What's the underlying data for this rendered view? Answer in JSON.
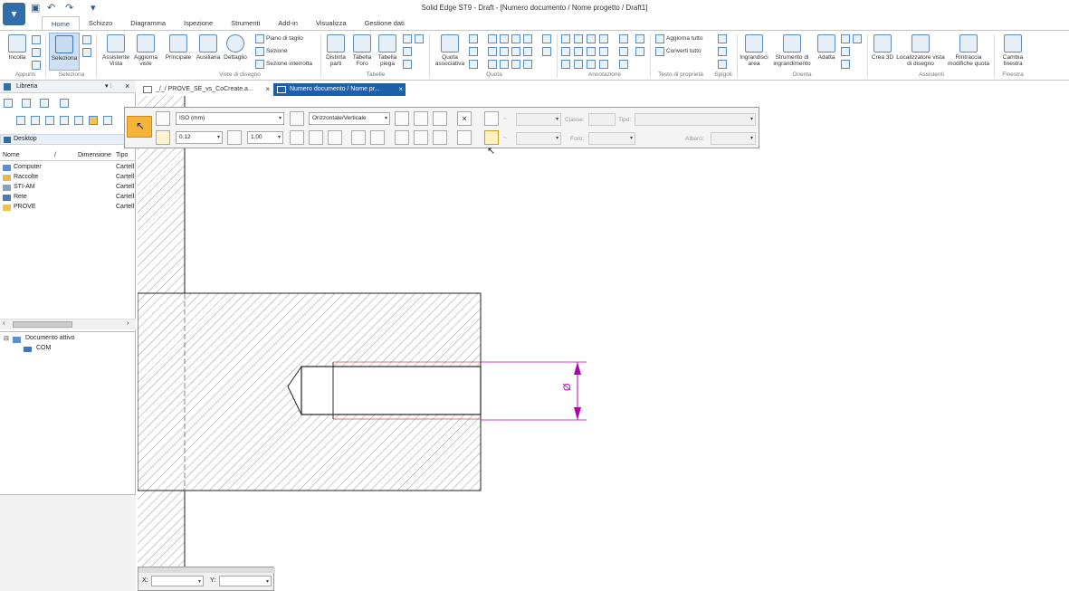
{
  "window": {
    "title": "Solid Edge ST9 - Draft - [Numero documento / Nome progetto / Draft1]"
  },
  "tabs": [
    "Home",
    "Schizzo",
    "Diagramma",
    "Ispezione",
    "Strumenti",
    "Add-in",
    "Visualizza",
    "Gestione dati"
  ],
  "ribbon": {
    "incolla": "Incolla",
    "seleziona": "Seleziona",
    "assistente_vista": "Assistente Vista",
    "aggiorna_viste": "Aggiorna viste",
    "principale": "Principale",
    "ausiliaria": "Ausiliaria",
    "dettaglio": "Dettaglio",
    "piano_taglio": "Piano di taglio",
    "sezione": "Sezione",
    "sezione_interrotta": "Sezione interrotta",
    "distinta_parti": "Distinta parti",
    "tabella_foro": "Tabella Foro",
    "tabella_piega": "Tabella piega",
    "quota_associativa": "Quota associativa",
    "aggiorna_tutto": "Aggiorna tutto",
    "converti_tutto": "Converti tutto",
    "ingrandisci_area": "Ingrandisci area",
    "strumento_ingrandimento": "Strumento di ingrandimento",
    "adatta": "Adatta",
    "crea_3d": "Crea 3D",
    "localizzatore": "Localizzatore vista di disegno",
    "rintraccia": "Rintraccia modifiche quota",
    "cambia_finestra": "Cambia finestra",
    "groups": {
      "appunti": "Appunti",
      "seleziona": "Seleziona",
      "viste": "Viste di disegno",
      "tabelle": "Tabelle",
      "quota": "Quota",
      "annotazione": "Annotazione",
      "testo": "Testo di proprietà",
      "spigoli": "Spigoli",
      "orienta": "Orienta",
      "assistenti": "Assistenti",
      "finestra": "Finestra"
    }
  },
  "library": {
    "title": "Libreria",
    "folder": "Desktop",
    "columns": [
      "Nome",
      "/",
      "Dimensione",
      "Tipo"
    ],
    "items": [
      {
        "name": "Computer",
        "type": "Cartell"
      },
      {
        "name": "Raccolte",
        "type": "Cartell"
      },
      {
        "name": "STI-AM",
        "type": "Cartell"
      },
      {
        "name": "Rete",
        "type": "Cartell"
      },
      {
        "name": "PROVE",
        "type": "Cartell"
      }
    ],
    "tree": {
      "root": "Documento attivo",
      "child": "COM"
    }
  },
  "doc_tabs": [
    {
      "label": "_/_/ PROVE_SE_vs_CoCreate.a...",
      "active": false
    },
    {
      "label": "Numero documento / Nome pr...",
      "active": true
    }
  ],
  "command_bar": {
    "style": "ISO (mm)",
    "orientation": "Orizzontale/Verticale",
    "precision": "0.12",
    "scale": "1.00",
    "x_close": "×",
    "dash1": "~",
    "dash2": "~",
    "classe_label": "Classe:",
    "tipo_label": "Tipo:",
    "foro_label": "Foro:",
    "albero_label": "Albero:"
  },
  "dimension": {
    "value": "Ø"
  },
  "coords": {
    "x_label": "X:",
    "y_label": "Y:"
  },
  "colors": {
    "accent": "#1d4f8a",
    "dimension": "#b000b0",
    "hatch": "#555555",
    "active_tab": "#1f5fa8"
  }
}
